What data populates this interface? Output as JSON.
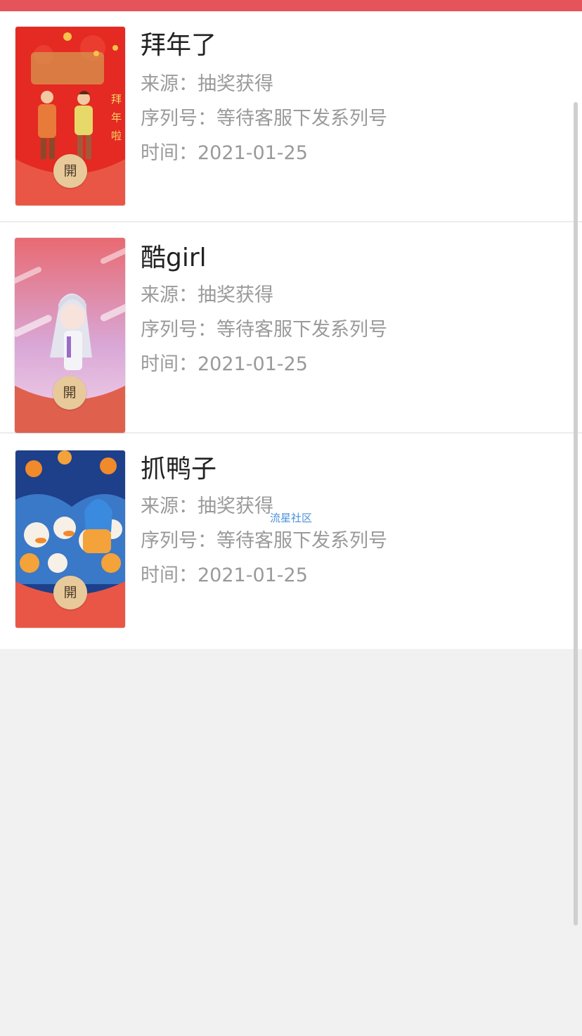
{
  "colors": {
    "top_bar": "#e5545a",
    "page_bg": "#f1f1f1",
    "card_bg": "#ffffff",
    "title_text": "#222222",
    "meta_text": "#9a9a9a",
    "badge_bg": "#e8c99a"
  },
  "items": [
    {
      "title": "拜年了",
      "source": "来源：抽奖获得",
      "serial": "序列号：等待客服下发系列号",
      "time": "时间：2021-01-25",
      "badge": "開",
      "cover_theme": "new-year-couple-red"
    },
    {
      "title": "酷girl",
      "source": "来源：抽奖获得",
      "serial": "序列号：等待客服下发系列号",
      "time": "时间：2021-01-25",
      "badge": "開",
      "cover_theme": "anime-girl-pink"
    },
    {
      "title": "抓鸭子",
      "source": "来源：抽奖获得",
      "serial": "序列号：等待客服下发系列号",
      "time": "时间：2021-01-25",
      "badge": "開",
      "cover_theme": "ducks-blue-orange"
    }
  ],
  "watermark": "流星社区"
}
